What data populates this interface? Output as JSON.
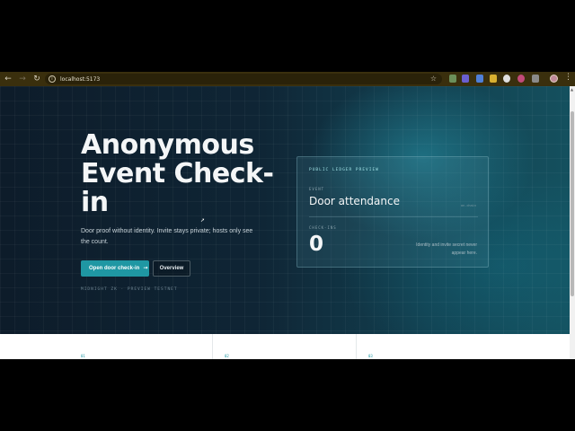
{
  "browser": {
    "back_icon": "←",
    "forward_icon": "→",
    "reload_icon": "↻",
    "site_info_icon": "i",
    "url": "localhost:5173",
    "bookmark_icon": "☆",
    "menu_icon": "⋮"
  },
  "hero": {
    "title": "Anonymous Event Check-in",
    "subtitle": "Door proof without identity. Invite stays private; hosts only see the count.",
    "primary_button": "Open door check-in",
    "primary_arrow": "→",
    "secondary_button": "Overview",
    "tag": "MIDNIGHT ZK · PREVIEW TESTNET"
  },
  "ledger": {
    "label": "PUBLIC LEDGER PREVIEW",
    "event_label": "EVENT",
    "event_name": "Door attendance",
    "event_sub": "on-chain",
    "checkins_label": "CHECK-INS",
    "checkins_count": "0",
    "note": "Identity and invite secret never appear here."
  },
  "steps": [
    "01",
    "02",
    "03"
  ],
  "colors": {
    "accent": "#1f97a3",
    "chrome": "#3a2f0d",
    "hero_bg": "#0f2535"
  }
}
